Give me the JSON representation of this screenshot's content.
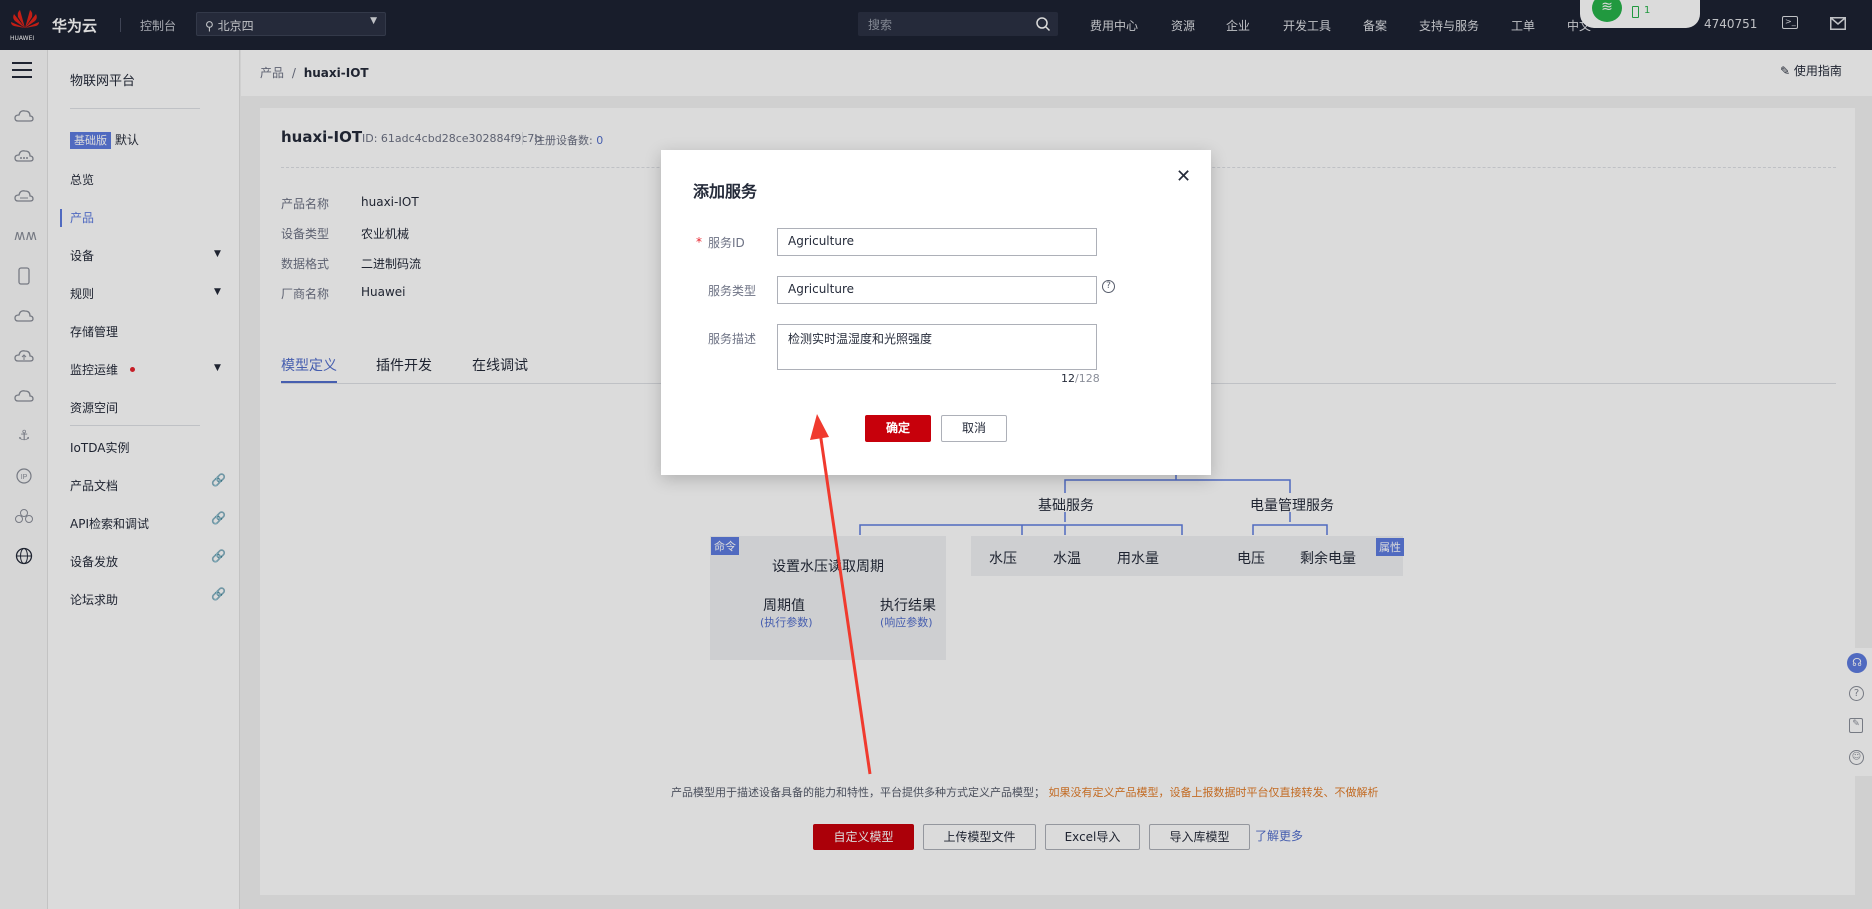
{
  "topbar": {
    "brand": "华为云",
    "logo_text": "HUAWEI",
    "console": "控制台",
    "region": "北京四",
    "search_placeholder": "搜索",
    "nav": [
      "费用中心",
      "资源",
      "企业",
      "开发工具",
      "备案",
      "支持与服务",
      "工单",
      "中文"
    ],
    "account": "4740751",
    "wifi_count": "1"
  },
  "sidemenu": {
    "title": "物联网平台",
    "edition_badge": "基础版",
    "edition_name": "默认",
    "items": [
      "总览",
      "产品",
      "设备",
      "规则",
      "存储管理",
      "监控运维",
      "资源空间",
      "IoTDA实例",
      "产品文档",
      "API检索和调试",
      "设备发放",
      "论坛求助"
    ]
  },
  "breadcrumb": {
    "root": "产品",
    "sep": "/",
    "current": "huaxi-IOT"
  },
  "guide": "使用指南",
  "product": {
    "name": "huaxi-IOT",
    "id_label": "ID: 61adc4cbd28ce302884f9c7b",
    "reg_label": "注册设备数:",
    "reg_count": "0",
    "fields": [
      {
        "label": "产品名称",
        "value": "huaxi-IOT"
      },
      {
        "label": "设备类型",
        "value": "农业机械"
      },
      {
        "label": "数据格式",
        "value": "二进制码流"
      },
      {
        "label": "厂商名称",
        "value": "Huawei"
      }
    ]
  },
  "tabs": [
    "模型定义",
    "插件开发",
    "在线调试"
  ],
  "diagram": {
    "basic_service": "基础服务",
    "power_service": "电量管理服务",
    "cmd_badge": "命令",
    "prop_badge": "属性",
    "cmd_name": "设置水压读取周期",
    "param1": "周期值",
    "param1_sub": "(执行参数)",
    "param2": "执行结果",
    "param2_sub": "(响应参数)",
    "props1": [
      "水压",
      "水温",
      "用水量"
    ],
    "props2": [
      "电压",
      "剩余电量"
    ]
  },
  "hint": {
    "normal": "产品模型用于描述设备具备的能力和特性，平台提供多种方式定义产品模型；",
    "warn": "如果没有定义产品模型，设备上报数据时平台仅直接转发、不做解析"
  },
  "actions": [
    "自定义模型",
    "上传模型文件",
    "Excel导入",
    "导入库模型"
  ],
  "learn_more": "了解更多",
  "modal": {
    "title": "添加服务",
    "required_mark": "*",
    "service_id_label": "服务ID",
    "service_id_value": "Agriculture",
    "service_type_label": "服务类型",
    "service_type_value": "Agriculture",
    "desc_label": "服务描述",
    "desc_value": "检测实时温湿度和光照强度",
    "count": "12",
    "max": "/128",
    "ok": "确定",
    "cancel": "取消"
  },
  "colors": {
    "brand_red": "#c7000b",
    "topbar": "#1d2233",
    "link_blue": "#526ecc",
    "annotation_arrow": "#f03a2e"
  }
}
